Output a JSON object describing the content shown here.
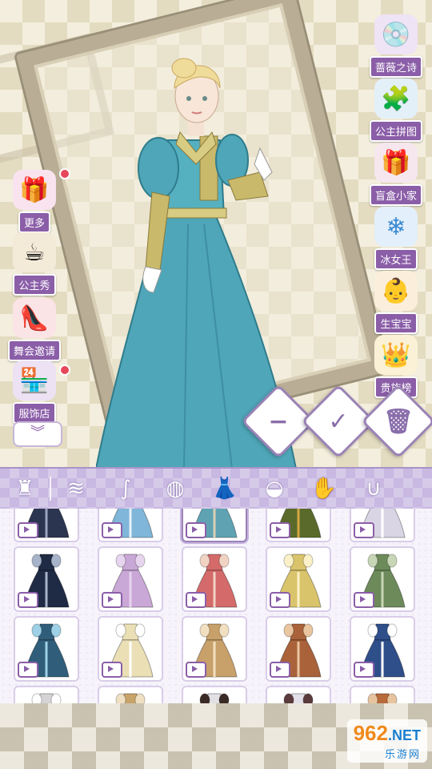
{
  "left_menu": [
    {
      "label": "更多",
      "icon": "gift-box-icon",
      "emoji": "🎁"
    },
    {
      "label": "公主秀",
      "icon": "teacup-icon",
      "emoji": "☕"
    },
    {
      "label": "舞会邀请",
      "icon": "high-heel-icon",
      "emoji": "👠"
    },
    {
      "label": "服饰店",
      "icon": "shop-icon",
      "emoji": "🏪"
    }
  ],
  "right_menu": [
    {
      "label": "蔷薇之诗",
      "icon": "music-disc-icon",
      "emoji": "💿"
    },
    {
      "label": "公主拼图",
      "icon": "puzzle-crown-icon",
      "emoji": "🧩"
    },
    {
      "label": "盲盒小家",
      "icon": "blind-box-icon",
      "emoji": "🎁"
    },
    {
      "label": "冰女王",
      "icon": "snowflake-icon",
      "emoji": "❄"
    },
    {
      "label": "生宝宝",
      "icon": "baby-icon",
      "emoji": "👶"
    },
    {
      "label": "贵族榜",
      "icon": "crown-icon",
      "emoji": "👑"
    }
  ],
  "actions": {
    "undo": "−",
    "confirm": "✓",
    "delete": "🗑"
  },
  "collapse": "︾",
  "categories": [
    {
      "icon": "mannequin-icon",
      "glyph": "♜"
    },
    {
      "icon": "hair-front-icon",
      "glyph": "≋"
    },
    {
      "icon": "hair-back-icon",
      "glyph": "∫"
    },
    {
      "icon": "makeup-icon",
      "glyph": "◍"
    },
    {
      "icon": "dress-icon",
      "glyph": "👗",
      "active": true
    },
    {
      "icon": "hat-icon",
      "glyph": "◒"
    },
    {
      "icon": "glove-icon",
      "glyph": "✋"
    },
    {
      "icon": "necklace-icon",
      "glyph": "∪"
    }
  ],
  "dresses": [
    {
      "color": "#2c3550",
      "accent": "#9aa4bf"
    },
    {
      "color": "#7fb6d9",
      "accent": "#e6f1f8"
    },
    {
      "color": "#5fa3b3",
      "accent": "#d8d0b2"
    },
    {
      "color": "#5a6a2a",
      "accent": "#d5a640"
    },
    {
      "color": "#d9d5e4",
      "accent": "#ffffff"
    },
    {
      "color": "#1f2a45",
      "accent": "#a7b3c9"
    },
    {
      "color": "#c9a7d6",
      "accent": "#e7d4ee"
    },
    {
      "color": "#d46a6a",
      "accent": "#f1d3c4"
    },
    {
      "color": "#d9c46c",
      "accent": "#fbf1c8"
    },
    {
      "color": "#6c8a5a",
      "accent": "#c7d6b5"
    },
    {
      "color": "#305e7a",
      "accent": "#9ed0e6"
    },
    {
      "color": "#eadfb5",
      "accent": "#ffffff"
    },
    {
      "color": "#c8a06a",
      "accent": "#f1dfc0"
    },
    {
      "color": "#a9623a",
      "accent": "#e9c5a0"
    },
    {
      "color": "#2f4f8a",
      "accent": "#ffffff"
    },
    {
      "color": "#d6d3d6",
      "accent": "#ffffff"
    },
    {
      "color": "#c9a46a",
      "accent": "#efe0c4"
    },
    {
      "color": "#e2e0e4",
      "accent": "#3a2a26"
    },
    {
      "color": "#e4e0ea",
      "accent": "#5a3a3a"
    },
    {
      "color": "#b86a3a",
      "accent": "#e8c49e"
    }
  ],
  "selected_index": 2,
  "watermark": {
    "logo_num": "962",
    "logo_tld": ".NET",
    "sub": "乐游网"
  }
}
